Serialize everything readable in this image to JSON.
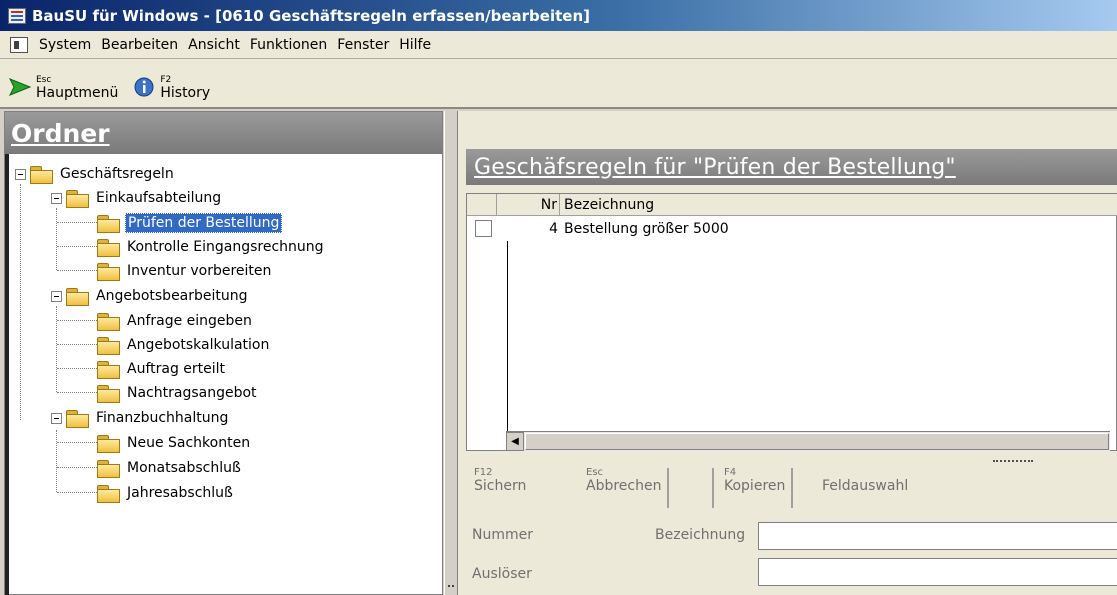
{
  "window": {
    "title": "BauSU für Windows - [0610 Geschäftsregeln erfassen/bearbeiten]"
  },
  "menu": [
    "System",
    "Bearbeiten",
    "Ansicht",
    "Funktionen",
    "Fenster",
    "Hilfe"
  ],
  "toolbar": {
    "main": {
      "key": "Esc",
      "label": "Hauptmenü"
    },
    "history": {
      "key": "F2",
      "label": "History"
    }
  },
  "left": {
    "header": "Ordner",
    "tree": {
      "root": "Geschäftsregeln",
      "groups": [
        {
          "label": "Einkaufsabteilung",
          "children": [
            "Prüfen der Bestellung",
            "Kontrolle Eingangsrechnung",
            "Inventur vorbereiten"
          ]
        },
        {
          "label": "Angebotsbearbeitung",
          "children": [
            "Anfrage eingeben",
            "Angebotskalkulation",
            "Auftrag erteilt",
            "Nachtragsangebot"
          ]
        },
        {
          "label": "Finanzbuchhaltung",
          "children": [
            "Neue Sachkonten",
            "Monatsabschluß",
            "Jahresabschluß"
          ]
        }
      ],
      "selected": "Prüfen der Bestellung"
    }
  },
  "right": {
    "header": "Geschäfsregeln für \"Prüfen der Bestellung\"",
    "grid": {
      "columns": [
        "Nr",
        "Bezeichnung"
      ],
      "rows": [
        {
          "nr": "4",
          "bez": "Bestellung größer 5000"
        }
      ]
    },
    "actions": {
      "save": {
        "key": "F12",
        "label": "Sichern"
      },
      "cancel": {
        "key": "Esc",
        "label": "Abbrechen"
      },
      "copy": {
        "key": "F4",
        "label": "Kopieren"
      },
      "fields": {
        "label": "Feldauswahl"
      }
    },
    "form": {
      "nummer": "Nummer",
      "bezeichnung": "Bezeichnung",
      "ausloeser": "Auslöser"
    }
  },
  "colors": {
    "title_gradient_start": "#0a246a",
    "selection": "#316ac5",
    "panel_header": "#8a8a8a"
  }
}
